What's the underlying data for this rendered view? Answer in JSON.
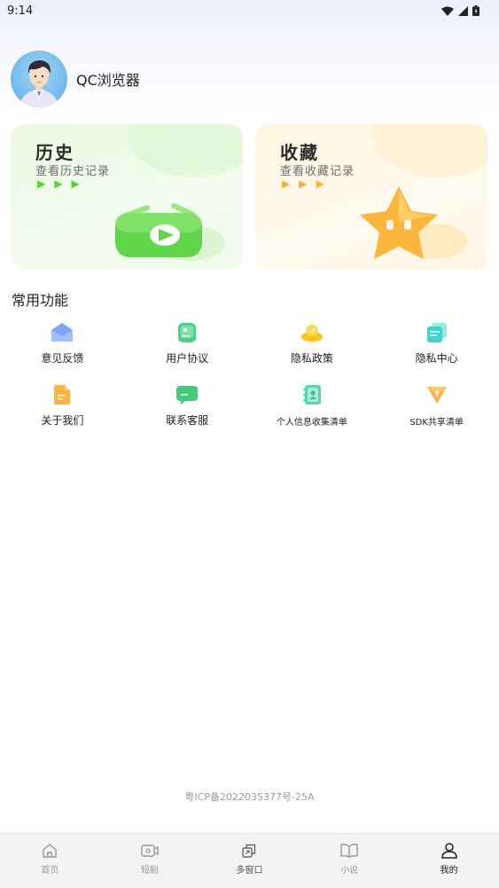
{
  "status_bar": {
    "time": "9:14"
  },
  "profile": {
    "name": "QC浏览器"
  },
  "cards": [
    {
      "title": "历史",
      "subtitle": "查看历史记录",
      "arrow_color": "#56d13a"
    },
    {
      "title": "收藏",
      "subtitle": "查看收藏记录",
      "arrow_color": "#f7b236"
    }
  ],
  "section": {
    "title": "常用功能"
  },
  "features": [
    {
      "label": "意见反馈",
      "icon": "feedback-icon"
    },
    {
      "label": "用户协议",
      "icon": "agreement-icon"
    },
    {
      "label": "隐私政策",
      "icon": "privacy-policy-icon"
    },
    {
      "label": "隐私中心",
      "icon": "privacy-center-icon"
    },
    {
      "label": "关于我们",
      "icon": "about-icon"
    },
    {
      "label": "联系客服",
      "icon": "customer-service-icon"
    },
    {
      "label": "个人信息收集清单",
      "icon": "personal-info-icon"
    },
    {
      "label": "SDK共享清单",
      "icon": "sdk-icon"
    }
  ],
  "footer": {
    "icp": "粤ICP备2022035377号-25A"
  },
  "bottom_nav": [
    {
      "label": "首页",
      "icon": "home-icon"
    },
    {
      "label": "短剧",
      "icon": "video-icon"
    },
    {
      "label": "多窗口",
      "icon": "windows-icon"
    },
    {
      "label": "小说",
      "icon": "book-icon"
    },
    {
      "label": "我的",
      "icon": "person-icon",
      "active": true
    }
  ]
}
